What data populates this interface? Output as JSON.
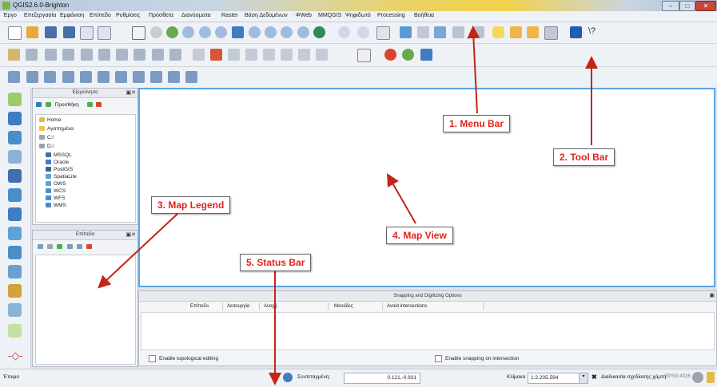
{
  "window": {
    "title": "QGIS2.6.0-Brighton"
  },
  "menubar": [
    "Έργο",
    "Επεξεργασία",
    "Εμφάνιση",
    "Επίπεδο",
    "Ρυθμίσεις",
    "Πρόσθετα",
    "Διανύσματα",
    "Raster",
    "Βάση Δεδομένων",
    "ΦWeb",
    "MMQGIS",
    "Ψηφιδωτό",
    "Processing",
    "Βοήθεια"
  ],
  "browser_panel": {
    "title": "Εξερεύνηση",
    "add_label": "Προσθήκη",
    "items": [
      "Home",
      "Αγαπημένα",
      "C:/",
      "D:/",
      "MSSQL",
      "Oracle",
      "PostGIS",
      "SpatiaLite",
      "OWS",
      "WCS",
      "WFS",
      "WMS"
    ]
  },
  "layers_panel": {
    "title": "Επίπεδα"
  },
  "snapping_panel": {
    "title": "Snapping and Digitizing Options",
    "columns": [
      "Επίπεδο",
      "Λειτουργία",
      "Ανοχή",
      "Μονάδες",
      "Avoid intersections"
    ],
    "topological_label": "Enable topological editing",
    "snap_intersection_label": "Enable snapping on intersection"
  },
  "statusbar": {
    "ready": "Έτοιμο",
    "coord_label": "Συντεταγμένη:",
    "coord_value": "0.121,-0.931",
    "scale_label": "Κλίμακα",
    "scale_value": "1:2.205.594",
    "render_label": "Διαδικασία σχεδίασης χάρτη",
    "epsg": "EPSG:4326"
  },
  "callouts": {
    "menu_bar": "1. Menu Bar",
    "tool_bar": "2. Tool Bar",
    "map_legend": "3. Map Legend",
    "map_view": "4. Map View",
    "status_bar": "5. Status Bar"
  },
  "colors": {
    "callout_text": "#e3231b",
    "arrow": "#c42418",
    "map_border": "#5aa6e6"
  }
}
